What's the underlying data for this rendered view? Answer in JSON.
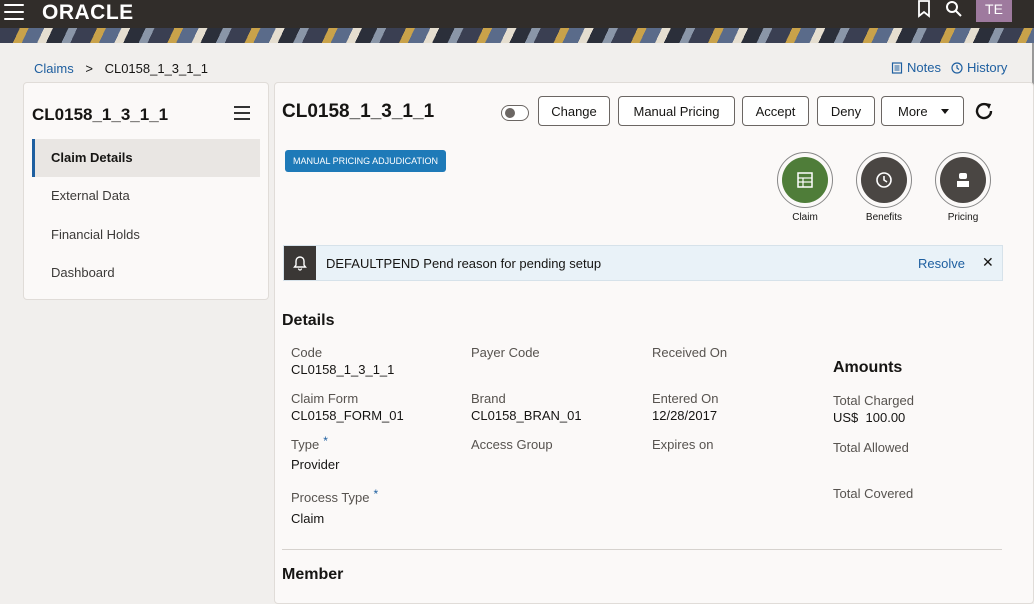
{
  "header": {
    "logo": "ORACLE",
    "avatar_initials": "TE",
    "icons": [
      "menu-icon",
      "bookmark-icon",
      "search-icon"
    ]
  },
  "breadcrumb": {
    "root": "Claims",
    "separator": ">",
    "current": "CL0158_1_3_1_1"
  },
  "top_links": {
    "notes": "Notes",
    "history": "History"
  },
  "sidebar": {
    "title": "CL0158_1_3_1_1",
    "items": [
      {
        "label": "Claim Details",
        "active": true
      },
      {
        "label": "External Data",
        "active": false
      },
      {
        "label": "Financial Holds",
        "active": false
      },
      {
        "label": "Dashboard",
        "active": false
      }
    ]
  },
  "main": {
    "title": "CL0158_1_3_1_1",
    "buttons": {
      "change": "Change",
      "manual_pricing": "Manual Pricing",
      "accept": "Accept",
      "deny": "Deny",
      "more": "More"
    },
    "badge": "MANUAL PRICING ADJUDICATION",
    "circles": [
      {
        "label": "Claim",
        "color": "#4f7d39",
        "icon": "table-icon"
      },
      {
        "label": "Benefits",
        "color": "#4a4643",
        "icon": "clock-icon"
      },
      {
        "label": "Pricing",
        "color": "#4a4643",
        "icon": "cashier-icon"
      }
    ],
    "alert": {
      "text": "DEFAULTPEND Pend reason for pending setup",
      "resolve": "Resolve",
      "close": "✕"
    },
    "details": {
      "title": "Details",
      "code_label": "Code",
      "code_value": "CL0158_1_3_1_1",
      "payer_code_label": "Payer Code",
      "received_on_label": "Received On",
      "claim_form_label": "Claim Form",
      "claim_form_value": "CL0158_FORM_01",
      "brand_label": "Brand",
      "brand_value": "CL0158_BRAN_01",
      "entered_on_label": "Entered On",
      "entered_on_value": "12/28/2017",
      "type_label": "Type",
      "type_value": "Provider",
      "access_group_label": "Access Group",
      "expires_on_label": "Expires on",
      "process_type_label": "Process Type",
      "process_type_value": "Claim",
      "required_mark": "*"
    },
    "amounts": {
      "title": "Amounts",
      "total_charged_label": "Total Charged",
      "total_charged_value": "US$  100.00",
      "total_allowed_label": "Total Allowed",
      "total_covered_label": "Total Covered"
    },
    "member_title": "Member"
  },
  "colors": {
    "accent": "#1e5fa0",
    "header_bg": "#312d2a",
    "badge_bg": "#1e7ab8",
    "claim_circle": "#4f7d39"
  }
}
